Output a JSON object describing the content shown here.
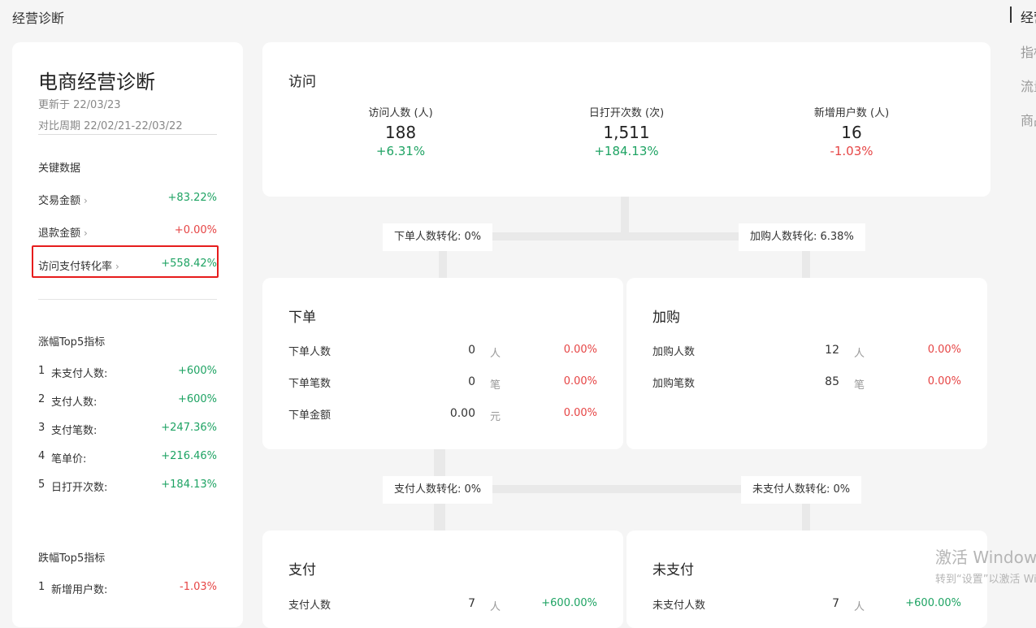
{
  "page": {
    "title": "经营诊断"
  },
  "left": {
    "title": "电商经营诊断",
    "updated": "更新于 22/03/23",
    "compare_period": "对比周期 22/02/21-22/03/22",
    "key_data_label": "关键数据",
    "key_data": [
      {
        "label": "交易金额",
        "value": "+83.22%",
        "trend": "up"
      },
      {
        "label": "退款金额",
        "value": "+0.00%",
        "trend": "down"
      },
      {
        "label": "访问支付转化率",
        "value": "+558.42%",
        "trend": "up"
      }
    ],
    "rise_label": "涨幅Top5指标",
    "rise_items": [
      {
        "n": "1",
        "label": "未支付人数:",
        "value": "+600%"
      },
      {
        "n": "2",
        "label": "支付人数:",
        "value": "+600%"
      },
      {
        "n": "3",
        "label": "支付笔数:",
        "value": "+247.36%"
      },
      {
        "n": "4",
        "label": "笔单价:",
        "value": "+216.46%"
      },
      {
        "n": "5",
        "label": "日打开次数:",
        "value": "+184.13%"
      }
    ],
    "fall_label": "跌幅Top5指标",
    "fall_items": [
      {
        "n": "1",
        "label": "新增用户数:",
        "value": "-1.03%"
      }
    ]
  },
  "visit": {
    "title": "访问",
    "metrics": [
      {
        "label": "访问人数 (人)",
        "value": "188",
        "change": "+6.31%",
        "trend": "up"
      },
      {
        "label": "日打开次数 (次)",
        "value": "1,511",
        "change": "+184.13%",
        "trend": "up"
      },
      {
        "label": "新增用户数 (人)",
        "value": "16",
        "change": "-1.03%",
        "trend": "down"
      }
    ]
  },
  "conversions": {
    "order": "下单人数转化: 0%",
    "cart": "加购人数转化: 6.38%",
    "pay": "支付人数转化: 0%",
    "unpaid": "未支付人数转化: 0%"
  },
  "order_card": {
    "title": "下单",
    "rows": [
      {
        "label": "下单人数",
        "value": "0",
        "unit": "人",
        "pct": "0.00%"
      },
      {
        "label": "下单笔数",
        "value": "0",
        "unit": "笔",
        "pct": "0.00%"
      },
      {
        "label": "下单金额",
        "value": "0.00",
        "unit": "元",
        "pct": "0.00%"
      }
    ]
  },
  "cart_card": {
    "title": "加购",
    "rows": [
      {
        "label": "加购人数",
        "value": "12",
        "unit": "人",
        "pct": "0.00%"
      },
      {
        "label": "加购笔数",
        "value": "85",
        "unit": "笔",
        "pct": "0.00%"
      }
    ]
  },
  "pay_card": {
    "title": "支付",
    "rows": [
      {
        "label": "支付人数",
        "value": "7",
        "unit": "人",
        "pct": "+600.00%"
      }
    ]
  },
  "unpaid_card": {
    "title": "未支付",
    "rows": [
      {
        "label": "未支付人数",
        "value": "7",
        "unit": "人",
        "pct": "+600.00%"
      }
    ]
  },
  "right_nav": [
    {
      "label": "经营诊断"
    },
    {
      "label": "指标"
    },
    {
      "label": "流量"
    },
    {
      "label": "商品"
    }
  ],
  "watermark": {
    "line1": "激活 Windows",
    "line2": "转到“设置”以激活 Windows。"
  },
  "colors": {
    "up": "#1ea363",
    "down": "#e64545",
    "highlight": "#e61c1c"
  }
}
